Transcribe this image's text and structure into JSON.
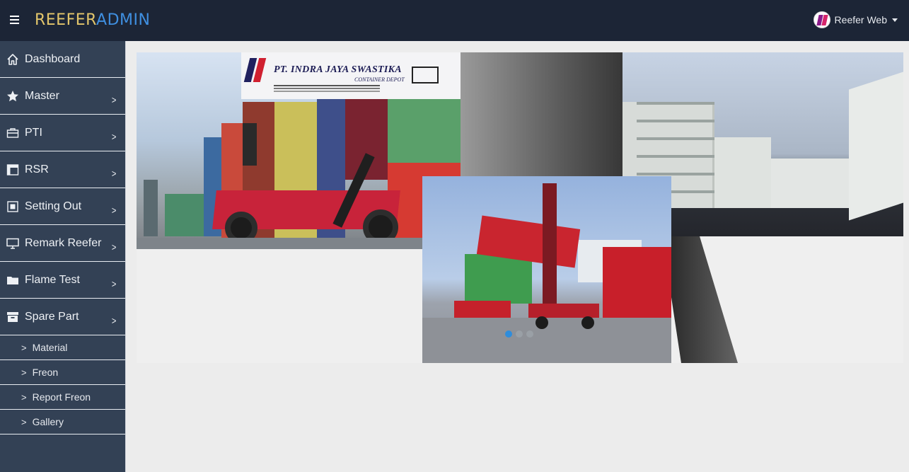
{
  "header": {
    "brand_part1": "REEFER",
    "brand_part2": "ADMIN",
    "user_name": "Reefer Web"
  },
  "sidebar": {
    "items": [
      {
        "label": "Dashboard",
        "icon": "home-icon",
        "has_submenu": false
      },
      {
        "label": "Master",
        "icon": "star-icon",
        "has_submenu": true
      },
      {
        "label": "PTI",
        "icon": "briefcase-icon",
        "has_submenu": true
      },
      {
        "label": "RSR",
        "icon": "window-icon",
        "has_submenu": true
      },
      {
        "label": "Setting Out",
        "icon": "square-icon",
        "has_submenu": true
      },
      {
        "label": "Remark Reefer",
        "icon": "monitor-icon",
        "has_submenu": true
      },
      {
        "label": "Flame Test",
        "icon": "folder-icon",
        "has_submenu": true
      },
      {
        "label": "Spare Part",
        "icon": "archive-icon",
        "has_submenu": true
      }
    ],
    "subitems": [
      {
        "label": "Material"
      },
      {
        "label": "Freon"
      },
      {
        "label": "Report Freon"
      },
      {
        "label": "Gallery"
      }
    ]
  },
  "carousel": {
    "logo_title": "PT. INDRA JAYA SWASTIKA",
    "logo_subtitle": "CONTAINER DEPOT",
    "slide_count": 3,
    "active_slide": 1
  },
  "colors": {
    "topbar": "#1c2536",
    "sidebar": "#334155",
    "brand_gold": "#e3c66b",
    "brand_blue": "#3f8fe0",
    "active_dot": "#2f8ddc"
  }
}
